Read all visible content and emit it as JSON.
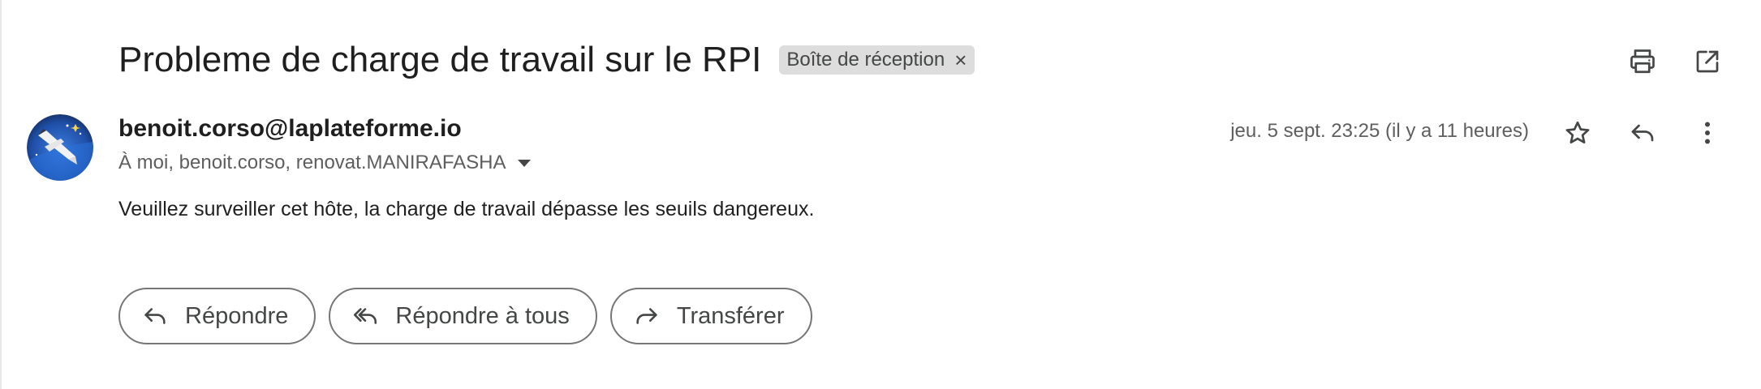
{
  "thread": {
    "subject": "Probleme de charge de travail sur le RPI",
    "label": "Boîte de réception",
    "label_remove": "×"
  },
  "toolbar": {
    "icons": [
      "printer-icon",
      "open-in-new-window-icon"
    ]
  },
  "message": {
    "sender": "benoit.corso@laplateforme.io",
    "recipients": "À moi, benoit.corso, renovat.MANIRAFASHA",
    "date": "jeu. 5 sept. 23:25 (il y a 11 heures)",
    "body": "Veuillez surveiller cet hôte, la charge de travail dépasse les seuils dangereux.",
    "icons": [
      "star-icon",
      "reply-icon",
      "more-vert-icon"
    ]
  },
  "actions": {
    "reply": "Répondre",
    "reply_all": "Répondre à tous",
    "forward": "Transférer"
  },
  "colors": {
    "text": "#1f1f1f",
    "muted": "#5e5e5e",
    "chip_bg": "#dddddd",
    "button_border": "#747775"
  }
}
